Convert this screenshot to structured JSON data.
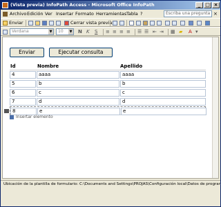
{
  "window": {
    "title": "(Vista previa) InfoPath Access - Microsoft Office InfoPath"
  },
  "menu": {
    "items": [
      "Archivo",
      "Edición",
      "Ver",
      "Insertar",
      "Formato",
      "Herramientas",
      "Tabla",
      "?"
    ],
    "ask_placeholder": "Escriba una pregunta"
  },
  "toolbar": {
    "send_label": "Enviar",
    "close_preview_label": "Cerrar vista previa",
    "font_name": "Verdana",
    "font_size": "10"
  },
  "form": {
    "buttons": {
      "send": "Enviar",
      "run_query": "Ejecutar consulta"
    },
    "columns": [
      "Id",
      "Nombre",
      "Apellido"
    ],
    "rows": [
      {
        "id": "4",
        "nombre": "aaaa",
        "apellido": "aaaa"
      },
      {
        "id": "5",
        "nombre": "b",
        "apellido": "b"
      },
      {
        "id": "6",
        "nombre": "c",
        "apellido": "c"
      },
      {
        "id": "7",
        "nombre": "d",
        "apellido": "d"
      },
      {
        "id": "8",
        "nombre": "e",
        "apellido": "e"
      }
    ],
    "insert_item": "Insertar elemento"
  },
  "status": {
    "text": "Ubicación de la plantilla de formulario: C:\\Documents and Settings\\PROJAS\\Configuración local\\Datos de programa\\"
  }
}
